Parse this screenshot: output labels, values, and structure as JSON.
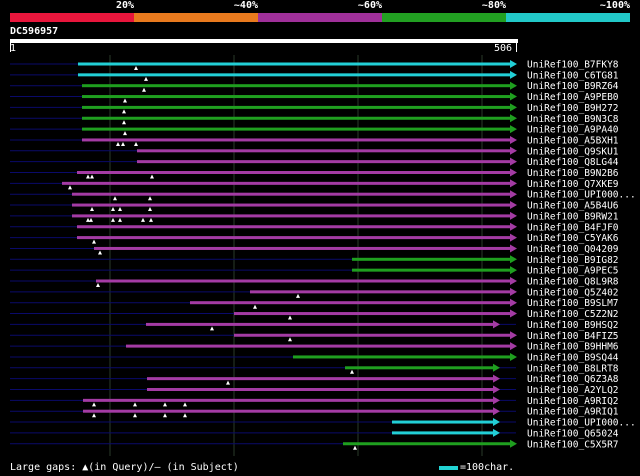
{
  "legend": {
    "labels": [
      "20%",
      "~40%",
      "~60%",
      "~80%",
      "~100%"
    ],
    "colors": [
      "#e8163c",
      "#e87a1e",
      "#a0309a",
      "#22a022",
      "#22c8c8"
    ]
  },
  "query": {
    "id": "DC596957",
    "start": "1",
    "end": "506"
  },
  "colors": {
    "cyan": "#22cfd6",
    "green": "#1f9f1f",
    "purple": "#a43ba4",
    "gap": "#0a0a6a",
    "grid": "#2a3a2a"
  },
  "hits": [
    {
      "name": "UniRef100_B7FKY8",
      "color": "cyan"
    },
    {
      "name": "UniRef100_C6TG81",
      "color": "cyan"
    },
    {
      "name": "UniRef100_B9RZ64",
      "color": "green"
    },
    {
      "name": "UniRef100_A9PEB0",
      "color": "green"
    },
    {
      "name": "UniRef100_B9H272",
      "color": "green"
    },
    {
      "name": "UniRef100_B9N3C8",
      "color": "green"
    },
    {
      "name": "UniRef100_A9PA40",
      "color": "green"
    },
    {
      "name": "UniRef100_A5BXH1",
      "color": "purple"
    },
    {
      "name": "UniRef100_Q9SKU1",
      "color": "purple"
    },
    {
      "name": "UniRef100_Q8LG44",
      "color": "purple"
    },
    {
      "name": "UniRef100_B9N2B6",
      "color": "purple"
    },
    {
      "name": "UniRef100_Q7XKE9",
      "color": "purple"
    },
    {
      "name": "UniRef100_UPI000...",
      "color": "purple"
    },
    {
      "name": "UniRef100_A5B4U6",
      "color": "purple"
    },
    {
      "name": "UniRef100_B9RW21",
      "color": "purple"
    },
    {
      "name": "UniRef100_B4FJF0",
      "color": "purple"
    },
    {
      "name": "UniRef100_C5YAK6",
      "color": "purple"
    },
    {
      "name": "UniRef100_Q04209",
      "color": "purple"
    },
    {
      "name": "UniRef100_B9IG82",
      "color": "green"
    },
    {
      "name": "UniRef100_A9PEC5",
      "color": "green"
    },
    {
      "name": "UniRef100_Q8L9R8",
      "color": "purple"
    },
    {
      "name": "UniRef100_Q5Z402",
      "color": "purple"
    },
    {
      "name": "UniRef100_B9SLM7",
      "color": "purple"
    },
    {
      "name": "UniRef100_C5Z2N2",
      "color": "purple"
    },
    {
      "name": "UniRef100_B9HSQ2",
      "color": "purple"
    },
    {
      "name": "UniRef100_B4FIZ5",
      "color": "purple"
    },
    {
      "name": "UniRef100_B9HHM6",
      "color": "purple"
    },
    {
      "name": "UniRef100_B9SQ44",
      "color": "green"
    },
    {
      "name": "UniRef100_B8LRT8",
      "color": "green"
    },
    {
      "name": "UniRef100_Q6Z3A8",
      "color": "purple"
    },
    {
      "name": "UniRef100_A2YLQ2",
      "color": "purple"
    },
    {
      "name": "UniRef100_A9RIQ2",
      "color": "purple"
    },
    {
      "name": "UniRef100_A9RIQ1",
      "color": "purple"
    },
    {
      "name": "UniRef100_UPI000...",
      "color": "cyan"
    },
    {
      "name": "UniRef100_Q65024",
      "color": "cyan"
    },
    {
      "name": "UniRef100_C5X5R7",
      "color": "green"
    }
  ],
  "footer": {
    "gaps_text": "Large gaps: ▲(in Query)/— (in Subject)",
    "scale_text": "=100char."
  }
}
